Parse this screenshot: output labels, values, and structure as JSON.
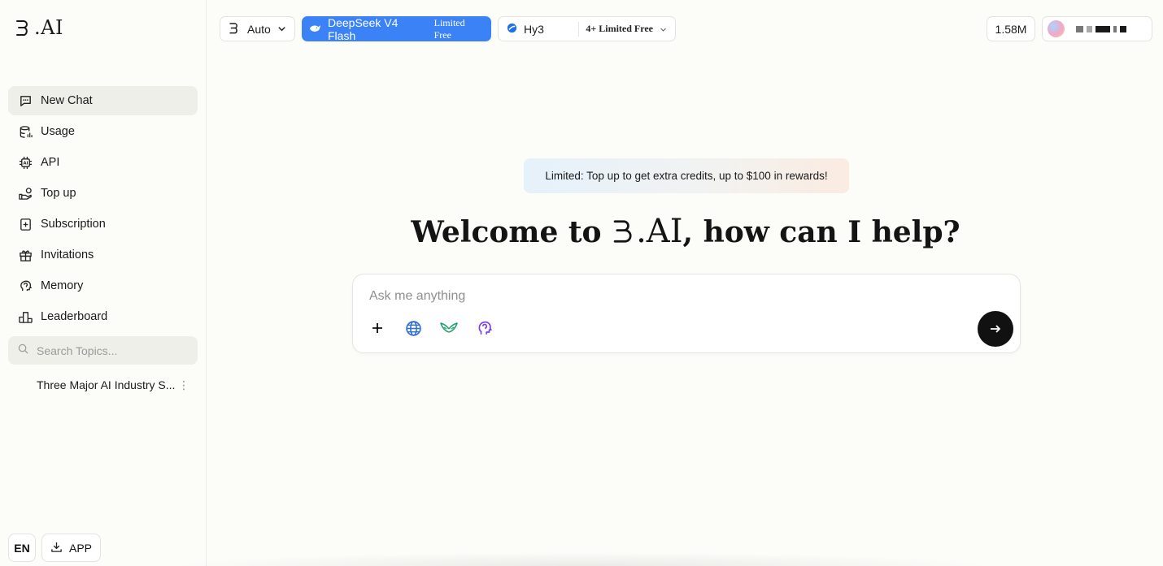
{
  "brand": {
    "logo_text": ".AI"
  },
  "sidebar": {
    "items": [
      {
        "label": "New Chat",
        "icon": "chat-bubble-icon",
        "active": true
      },
      {
        "label": "Usage",
        "icon": "database-icon"
      },
      {
        "label": "API",
        "icon": "chip-icon"
      },
      {
        "label": "Top up",
        "icon": "hand-coin-icon"
      },
      {
        "label": "Subscription",
        "icon": "subscription-icon"
      },
      {
        "label": "Invitations",
        "icon": "gift-icon"
      },
      {
        "label": "Memory",
        "icon": "brain-icon"
      },
      {
        "label": "Leaderboard",
        "icon": "podium-icon"
      }
    ],
    "search_placeholder": "Search Topics...",
    "topics": [
      {
        "title": "Three Major AI Industry S..."
      }
    ],
    "language_button": "EN",
    "app_button": "APP"
  },
  "topbar": {
    "mode": "Auto",
    "model_primary": {
      "name": "DeepSeek V4 Flash",
      "tag": "Limited Free"
    },
    "model_secondary": {
      "name": "Hy3",
      "tag": "4+ Limited Free"
    },
    "credits": "1.58M"
  },
  "main": {
    "banner": "Limited: Top up to get extra credits, up to $100 in rewards!",
    "welcome_prefix": "Welcome to ",
    "welcome_brand": ".AI",
    "welcome_suffix": ", how can I help?",
    "input_placeholder": "Ask me anything"
  },
  "colors": {
    "accent": "#3b82f6",
    "background": "#fcfcf9",
    "send_button": "#111111",
    "globe_icon": "#2f6fd6",
    "wings_icon": "#22a06b",
    "brain_icon": "#7c3aed"
  }
}
